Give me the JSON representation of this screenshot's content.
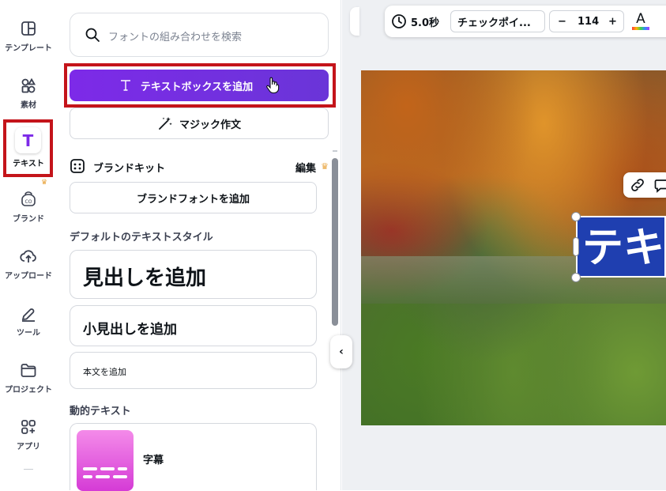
{
  "rail": {
    "items": [
      {
        "label": "テンプレート",
        "icon": "template-icon"
      },
      {
        "label": "素材",
        "icon": "elements-icon"
      },
      {
        "label": "テキスト",
        "icon": "text-icon"
      },
      {
        "label": "ブランド",
        "icon": "brand-icon"
      },
      {
        "label": "アップロード",
        "icon": "upload-icon"
      },
      {
        "label": "ツール",
        "icon": "tools-icon"
      },
      {
        "label": "プロジェクト",
        "icon": "folder-icon"
      },
      {
        "label": "アプリ",
        "icon": "apps-icon"
      }
    ],
    "active": "テキスト"
  },
  "panel": {
    "search_placeholder": "フォントの組み合わせを検索",
    "add_textbox": "テキストボックスを追加",
    "magic_write": "マジック作文",
    "brand_kit": "ブランドキット",
    "brand_edit": "編集",
    "add_brand_font": "ブランドフォントを追加",
    "default_styles_title": "デフォルトのテキストスタイル",
    "add_heading": "見出しを追加",
    "add_subheading": "小見出しを追加",
    "add_body": "本文を追加",
    "dynamic_title": "動的テキスト",
    "captions": "字幕"
  },
  "toolbar": {
    "duration": "5.0秒",
    "checkpoint": "チェックポイ...",
    "font_size": "114",
    "minus": "−",
    "plus": "+",
    "text_color_glyph": "A"
  },
  "canvas": {
    "text_element": "テキ"
  },
  "colors": {
    "accent": "#7d2ae8",
    "highlight": "#c4141a",
    "text_bg": "#1f3fb0"
  }
}
